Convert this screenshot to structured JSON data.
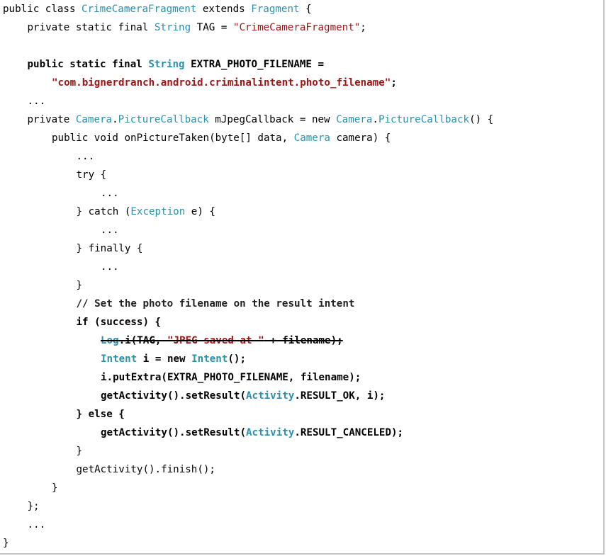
{
  "code": {
    "indent_unit": "    ",
    "lines": [
      {
        "indent": 0,
        "tokens": [
          {
            "t": "public class ",
            "c": "plain"
          },
          {
            "t": "CrimeCameraFragment",
            "c": "type"
          },
          {
            "t": " extends ",
            "c": "plain"
          },
          {
            "t": "Fragment",
            "c": "type"
          },
          {
            "t": " {",
            "c": "plain"
          }
        ]
      },
      {
        "indent": 1,
        "tokens": [
          {
            "t": "private static final ",
            "c": "plain"
          },
          {
            "t": "String",
            "c": "type"
          },
          {
            "t": " TAG = ",
            "c": "plain"
          },
          {
            "t": "\"CrimeCameraFragment\"",
            "c": "str"
          },
          {
            "t": ";",
            "c": "plain"
          }
        ]
      },
      {
        "indent": 0,
        "tokens": []
      },
      {
        "indent": 1,
        "bold": true,
        "tokens": [
          {
            "t": "public static final ",
            "c": "plain"
          },
          {
            "t": "String",
            "c": "type"
          },
          {
            "t": " EXTRA_PHOTO_FILENAME =",
            "c": "plain"
          }
        ]
      },
      {
        "indent": 2,
        "bold": true,
        "tokens": [
          {
            "t": "\"com.bignerdranch.android.criminalintent.photo_filename\"",
            "c": "str"
          },
          {
            "t": ";",
            "c": "plain"
          }
        ]
      },
      {
        "indent": 1,
        "tokens": [
          {
            "t": "...",
            "c": "plain"
          }
        ]
      },
      {
        "indent": 1,
        "tokens": [
          {
            "t": "private ",
            "c": "plain"
          },
          {
            "t": "Camera",
            "c": "type"
          },
          {
            "t": ".",
            "c": "plain"
          },
          {
            "t": "PictureCallback",
            "c": "type"
          },
          {
            "t": " mJpegCallback = new ",
            "c": "plain"
          },
          {
            "t": "Camera",
            "c": "type"
          },
          {
            "t": ".",
            "c": "plain"
          },
          {
            "t": "PictureCallback",
            "c": "type"
          },
          {
            "t": "() {",
            "c": "plain"
          }
        ]
      },
      {
        "indent": 2,
        "tokens": [
          {
            "t": "public void onPictureTaken(byte[] data, ",
            "c": "plain"
          },
          {
            "t": "Camera",
            "c": "type"
          },
          {
            "t": " camera) {",
            "c": "plain"
          }
        ]
      },
      {
        "indent": 3,
        "tokens": [
          {
            "t": "...",
            "c": "plain"
          }
        ]
      },
      {
        "indent": 3,
        "tokens": [
          {
            "t": "try {",
            "c": "plain"
          }
        ]
      },
      {
        "indent": 4,
        "tokens": [
          {
            "t": "...",
            "c": "plain"
          }
        ]
      },
      {
        "indent": 3,
        "tokens": [
          {
            "t": "} catch (",
            "c": "plain"
          },
          {
            "t": "Exception",
            "c": "type"
          },
          {
            "t": " e) {",
            "c": "plain"
          }
        ]
      },
      {
        "indent": 4,
        "tokens": [
          {
            "t": "...",
            "c": "plain"
          }
        ]
      },
      {
        "indent": 3,
        "tokens": [
          {
            "t": "} finally {",
            "c": "plain"
          }
        ]
      },
      {
        "indent": 4,
        "tokens": [
          {
            "t": "...",
            "c": "plain"
          }
        ]
      },
      {
        "indent": 3,
        "tokens": [
          {
            "t": "}",
            "c": "plain"
          }
        ]
      },
      {
        "indent": 3,
        "bold": true,
        "tokens": [
          {
            "t": "// Set the photo filename on the result intent",
            "c": "cmt"
          }
        ]
      },
      {
        "indent": 3,
        "bold": true,
        "tokens": [
          {
            "t": "if (success) {",
            "c": "plain"
          }
        ]
      },
      {
        "indent": 4,
        "bold": true,
        "strike": true,
        "tokens": [
          {
            "t": "Log",
            "c": "type"
          },
          {
            "t": ".i(TAG, ",
            "c": "plain"
          },
          {
            "t": "\"JPEG saved at \"",
            "c": "str"
          },
          {
            "t": " + filename);",
            "c": "plain"
          }
        ]
      },
      {
        "indent": 4,
        "bold": true,
        "tokens": [
          {
            "t": "Intent",
            "c": "type"
          },
          {
            "t": " i = new ",
            "c": "plain"
          },
          {
            "t": "Intent",
            "c": "type"
          },
          {
            "t": "();",
            "c": "plain"
          }
        ]
      },
      {
        "indent": 4,
        "bold": true,
        "tokens": [
          {
            "t": "i.putExtra(EXTRA_PHOTO_FILENAME, filename);",
            "c": "plain"
          }
        ]
      },
      {
        "indent": 4,
        "bold": true,
        "tokens": [
          {
            "t": "getActivity().setResult(",
            "c": "plain"
          },
          {
            "t": "Activity",
            "c": "type"
          },
          {
            "t": ".RESULT_OK, i);",
            "c": "plain"
          }
        ]
      },
      {
        "indent": 3,
        "bold": true,
        "tokens": [
          {
            "t": "} else {",
            "c": "plain"
          }
        ]
      },
      {
        "indent": 4,
        "bold": true,
        "tokens": [
          {
            "t": "getActivity().setResult(",
            "c": "plain"
          },
          {
            "t": "Activity",
            "c": "type"
          },
          {
            "t": ".RESULT_CANCELED);",
            "c": "plain"
          }
        ]
      },
      {
        "indent": 3,
        "tokens": [
          {
            "t": "}",
            "c": "plain"
          }
        ]
      },
      {
        "indent": 3,
        "tokens": [
          {
            "t": "getActivity().finish();",
            "c": "plain"
          }
        ]
      },
      {
        "indent": 2,
        "tokens": [
          {
            "t": "}",
            "c": "plain"
          }
        ]
      },
      {
        "indent": 1,
        "tokens": [
          {
            "t": "};",
            "c": "plain"
          }
        ]
      },
      {
        "indent": 1,
        "tokens": [
          {
            "t": "...",
            "c": "plain"
          }
        ]
      },
      {
        "indent": 0,
        "tokens": [
          {
            "t": "}",
            "c": "plain"
          }
        ]
      }
    ]
  },
  "colors": {
    "type": "#2b91af",
    "string": "#a31515",
    "plain": "#000000",
    "background": "#ffffff"
  }
}
